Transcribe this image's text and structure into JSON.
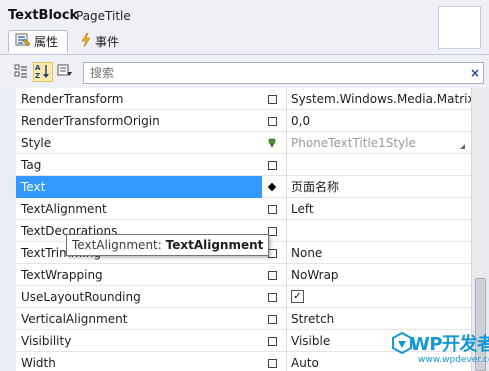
{
  "header": {
    "element_type": "TextBlock",
    "element_name": "PageTitle",
    "tabs": [
      {
        "label": "属性",
        "icon": "properties-icon"
      },
      {
        "label": "事件",
        "icon": "lightning-icon"
      }
    ]
  },
  "toolbar": {
    "buttons": [
      "categorized-view-icon",
      "alphabetical-sort-icon",
      "property-filter-icon"
    ]
  },
  "search": {
    "placeholder": "搜索",
    "clear_label": "×"
  },
  "properties": [
    {
      "name": "RenderTransform",
      "value": "System.Windows.Media.Matrix"
    },
    {
      "name": "RenderTransformOrigin",
      "value": "0,0"
    },
    {
      "name": "Style",
      "value": "PhoneTextTitle1Style"
    },
    {
      "name": "Tag",
      "value": ""
    },
    {
      "name": "Text",
      "value": "页面名称"
    },
    {
      "name": "TextAlignment",
      "value": "Left"
    },
    {
      "name": "TextDecorations",
      "value": ""
    },
    {
      "name": "TextTrimming",
      "value": "None"
    },
    {
      "name": "TextWrapping",
      "value": "NoWrap"
    },
    {
      "name": "UseLayoutRounding",
      "value": "✓"
    },
    {
      "name": "VerticalAlignment",
      "value": "Stretch"
    },
    {
      "name": "Visibility",
      "value": "Visible"
    },
    {
      "name": "Width",
      "value": "Auto"
    }
  ],
  "selected_property": "Text",
  "tooltip": {
    "prefix": "TextAlignment:",
    "type": "TextAlignment"
  },
  "watermark": {
    "brand": "WP开发者",
    "url": "www.wpdever.com"
  },
  "colors": {
    "selection": "#3399ff",
    "style_marker": "#4a8f2a",
    "watermark": "#1797d6"
  }
}
